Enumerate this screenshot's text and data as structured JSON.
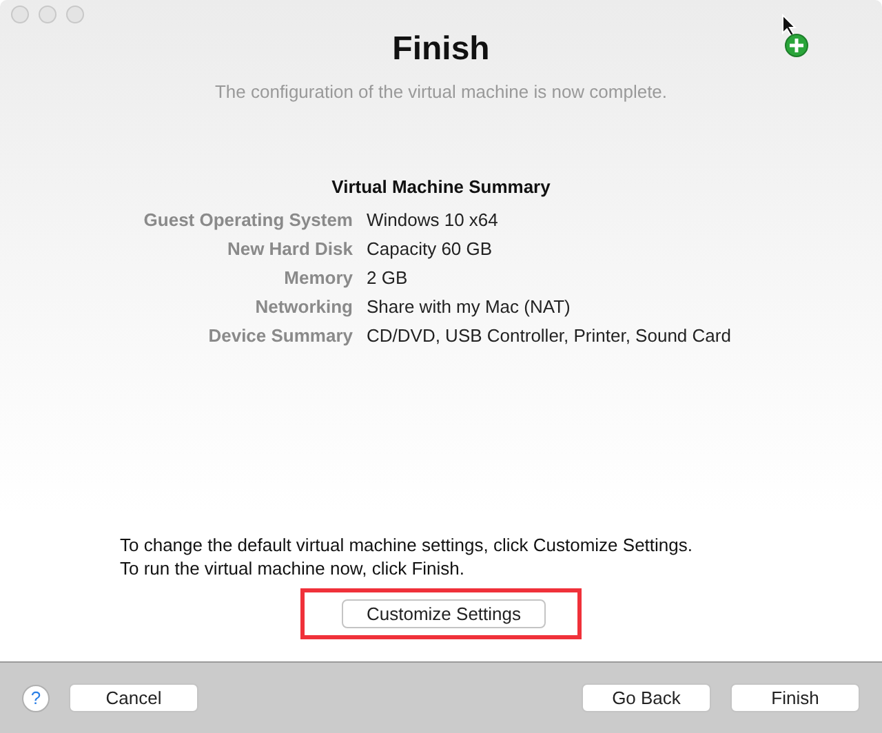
{
  "window": {
    "title": "Finish",
    "subtitle": "The configuration of the virtual machine is now complete."
  },
  "summary": {
    "heading": "Virtual Machine Summary",
    "rows": [
      {
        "label": "Guest Operating System",
        "value": "Windows 10 x64"
      },
      {
        "label": "New Hard Disk",
        "value": "Capacity 60 GB"
      },
      {
        "label": "Memory",
        "value": "2 GB"
      },
      {
        "label": "Networking",
        "value": "Share with my Mac (NAT)"
      },
      {
        "label": "Device Summary",
        "value": "CD/DVD, USB Controller, Printer, Sound Card"
      }
    ]
  },
  "instructions": [
    "To change the default virtual machine settings, click Customize Settings.",
    "To run the virtual machine now, click Finish."
  ],
  "customize_button": {
    "label": "Customize Settings",
    "highlighted": true
  },
  "footer": {
    "help": "?",
    "left_buttons": [
      "Cancel"
    ],
    "right_buttons": [
      "Go Back",
      "Finish"
    ]
  }
}
